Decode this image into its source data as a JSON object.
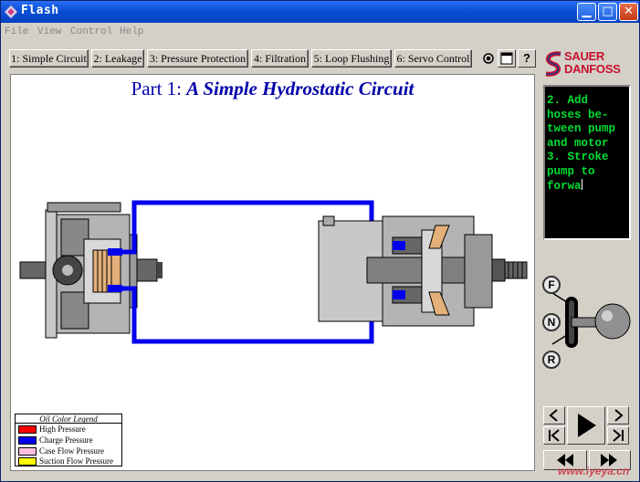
{
  "window": {
    "title": "Flash"
  },
  "menu": [
    "File",
    "View",
    "Control",
    "Help"
  ],
  "tabs": [
    "1: Simple Circuit",
    "2: Leakage",
    "3: Pressure Protection",
    "4: Filtration",
    "5: Loop Flushing",
    "6: Servo Control"
  ],
  "toolbar_icons": {
    "record": "record-icon",
    "window": "window-icon",
    "help": "?"
  },
  "stage": {
    "title_prefix": "Part 1:",
    "title_emphasis": "A Simple Hydrostatic Circuit"
  },
  "legend": {
    "title": "Oil Color Legend",
    "items": [
      {
        "label": "High Pressure",
        "color": "#ff0000"
      },
      {
        "label": "Charge Pressure",
        "color": "#0000ee"
      },
      {
        "label": "Case Flow Pressure",
        "color": "#ffc0e0"
      },
      {
        "label": "Suction Flow Pressure",
        "color": "#ffff00"
      }
    ]
  },
  "logo": {
    "line1": "SAUER",
    "line2": "DANFOSS"
  },
  "instructions": {
    "lines": [
      "2. Add",
      "hoses be-",
      "tween pump",
      "and motor",
      "",
      "3. Stroke",
      "pump to",
      "forwa"
    ]
  },
  "lever": {
    "forward": "F",
    "neutral": "N",
    "reverse": "R",
    "selected": "N"
  },
  "colors": {
    "charge_line": "#0000ee",
    "title_blue": "#0000aa",
    "terminal_green": "#00dd33"
  },
  "watermark": "www.iyeya.cn"
}
